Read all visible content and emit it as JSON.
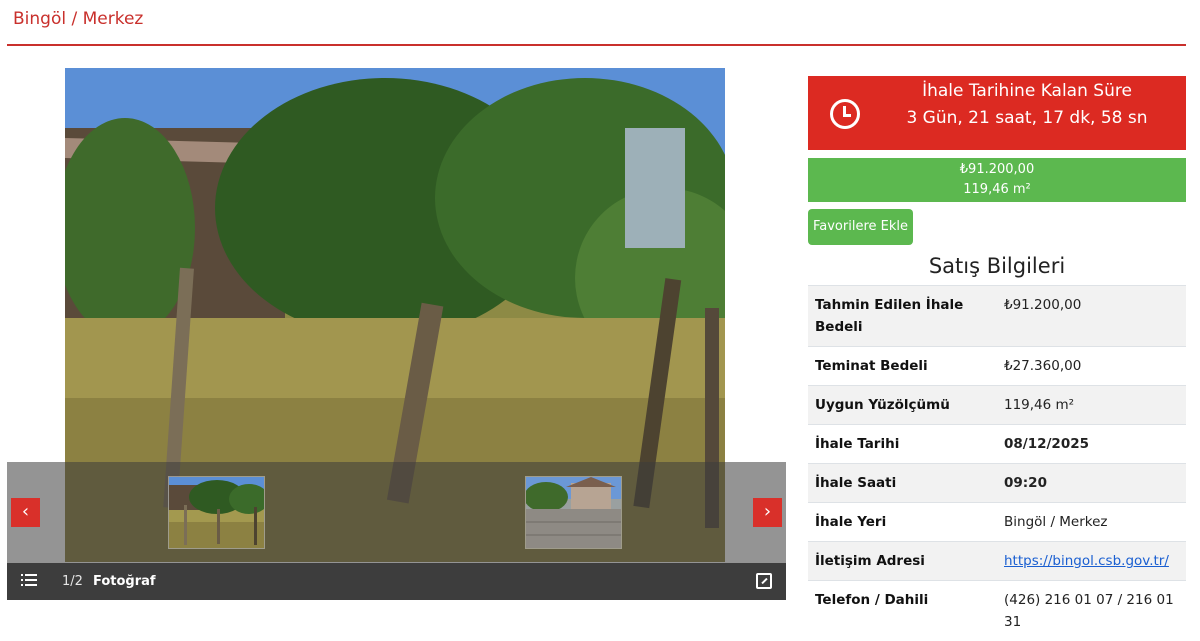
{
  "header": {
    "title": "Bingöl / Merkez"
  },
  "gallery": {
    "counter": "1/2",
    "caption": "Fotoğraf",
    "photo_icon": "list-icon",
    "expand_icon": "expand-icon",
    "prev_label": "‹",
    "next_label": "›"
  },
  "countdown": {
    "title": "İhale Tarihine Kalan Süre",
    "time": "3 Gün, 21 saat, 17 dk, 58 sn",
    "icon": "clock-icon"
  },
  "price": {
    "amount": "₺91.200,00",
    "area": "119,46 m²"
  },
  "favorite_button": "Favorilere Ekle",
  "sales_info": {
    "title": "Satış Bilgileri",
    "rows": [
      {
        "label": "Tahmin Edilen İhale Bedeli",
        "value": "₺91.200,00"
      },
      {
        "label": "Teminat Bedeli",
        "value": "₺27.360,00"
      },
      {
        "label": "Uygun Yüzölçümü",
        "value": "119,46 m²"
      },
      {
        "label": "İhale Tarihi",
        "value": "08/12/2025"
      },
      {
        "label": "İhale Saati",
        "value": "09:20"
      },
      {
        "label": "İhale Yeri",
        "value": "Bingöl / Merkez"
      },
      {
        "label": "İletişim Adresi",
        "value": "https://bingol.csb.gov.tr/"
      },
      {
        "label": "Telefon / Dahili",
        "value": "(426) 216 01 07 / 216 01 31"
      }
    ]
  },
  "colors": {
    "brand_red": "#c9302c",
    "countdown_red": "#dc2a22",
    "green": "#5cb84f",
    "link": "#1a5fd1"
  }
}
